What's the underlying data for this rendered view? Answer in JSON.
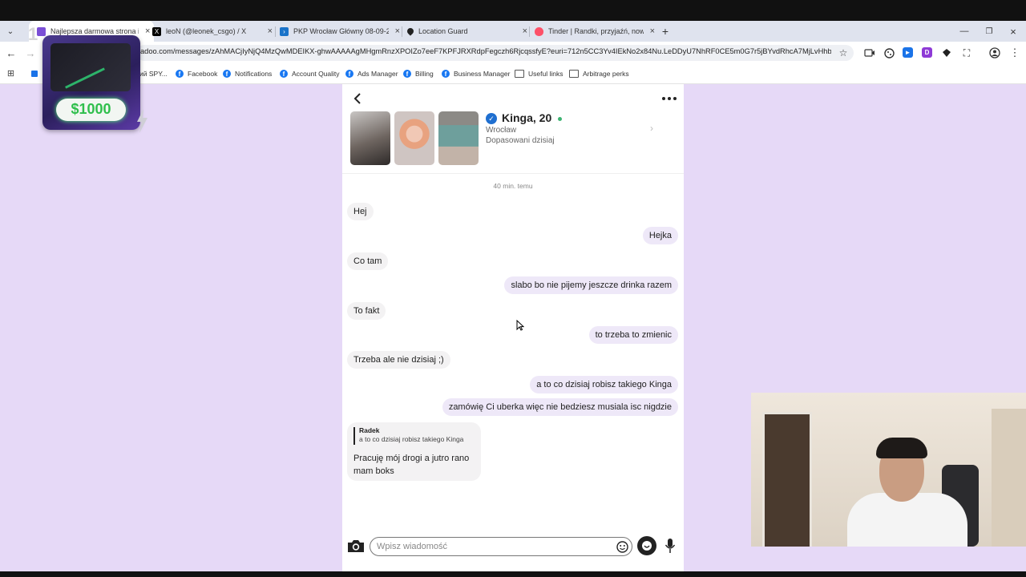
{
  "browser": {
    "tabs": [
      {
        "title": "Najlepsza darmowa strona i ap",
        "favicon": "badoo-icon",
        "active": true
      },
      {
        "title": "leoN (@leonek_csgo) / X",
        "favicon": "x-icon"
      },
      {
        "title": "PKP Wrocław Główny 08-09-20",
        "favicon": "pkp-icon"
      },
      {
        "title": "Location Guard",
        "favicon": "location-guard-icon"
      },
      {
        "title": "Tinder | Randki, przyjaźń, nowe",
        "favicon": "tinder-icon"
      }
    ],
    "new_tab": "+",
    "window_controls": [
      "minimize",
      "restore",
      "close"
    ],
    "url": "adoo.com/messages/zAhMACjIyNjQ4MzQwMDEIKX-ghwAAAAAgMHgmRnzXPOIZo7eeF7KPFJRXRdpFegczh6RjcqssfyE?euri=712n5CC3Yv4IEkNo2x84Nu.LeDDyU7NhRF0CE5m0G7r5jBYvdRhcA7MjLvHhbZo-ZW...",
    "bookmarks": [
      {
        "label": "ий SPY...",
        "icon": "spy-icon"
      },
      {
        "label": "Facebook",
        "icon": "facebook-icon"
      },
      {
        "label": "Notifications",
        "icon": "facebook-icon"
      },
      {
        "label": "Account Quality",
        "icon": "facebook-icon"
      },
      {
        "label": "Ads Manager",
        "icon": "facebook-icon"
      },
      {
        "label": "Billing",
        "icon": "facebook-icon"
      },
      {
        "label": "Business Manager",
        "icon": "facebook-icon"
      },
      {
        "label": "Useful links",
        "icon": "folder-icon"
      },
      {
        "label": "Arbitrage perks",
        "icon": "folder-icon"
      }
    ]
  },
  "overlay": {
    "promo_amount": "$1000",
    "promo_badge": "1"
  },
  "chat": {
    "profile": {
      "name": "Kinga, 20",
      "city": "Wrocław",
      "matched": "Dopasowani dzisiaj",
      "online": true,
      "verified": true
    },
    "timestamp": "40 min. temu",
    "messages": [
      {
        "side": "in",
        "text": "Hej"
      },
      {
        "side": "out",
        "text": "Hejka"
      },
      {
        "side": "in",
        "text": "Co tam"
      },
      {
        "side": "out",
        "text": "slabo bo nie pijemy jeszcze drinka razem"
      },
      {
        "side": "in",
        "text": "To fakt"
      },
      {
        "side": "out",
        "text": "to trzeba to zmienic"
      },
      {
        "side": "in",
        "text": "Trzeba ale nie dzisiaj ;)"
      },
      {
        "side": "out",
        "text": "a to co dzisiaj robisz takiego Kinga"
      },
      {
        "side": "out",
        "text": "zamówię Ci uberka więc nie bedziesz musiala isc nigdzie"
      }
    ],
    "reply": {
      "author": "Radek",
      "quoted": "a to co dzisiaj robisz takiego Kinga",
      "line1": "Pracuję mój drogi a jutro rano",
      "line2": "mam boks"
    },
    "input_placeholder": "Wpisz wiadomość"
  },
  "colors": {
    "accent": "#1f6fd0",
    "online": "#3cb371",
    "page_bg": "#e6d9f7",
    "outgoing_bubble": "#eee8f8",
    "incoming_bubble": "#f3f2f3"
  }
}
